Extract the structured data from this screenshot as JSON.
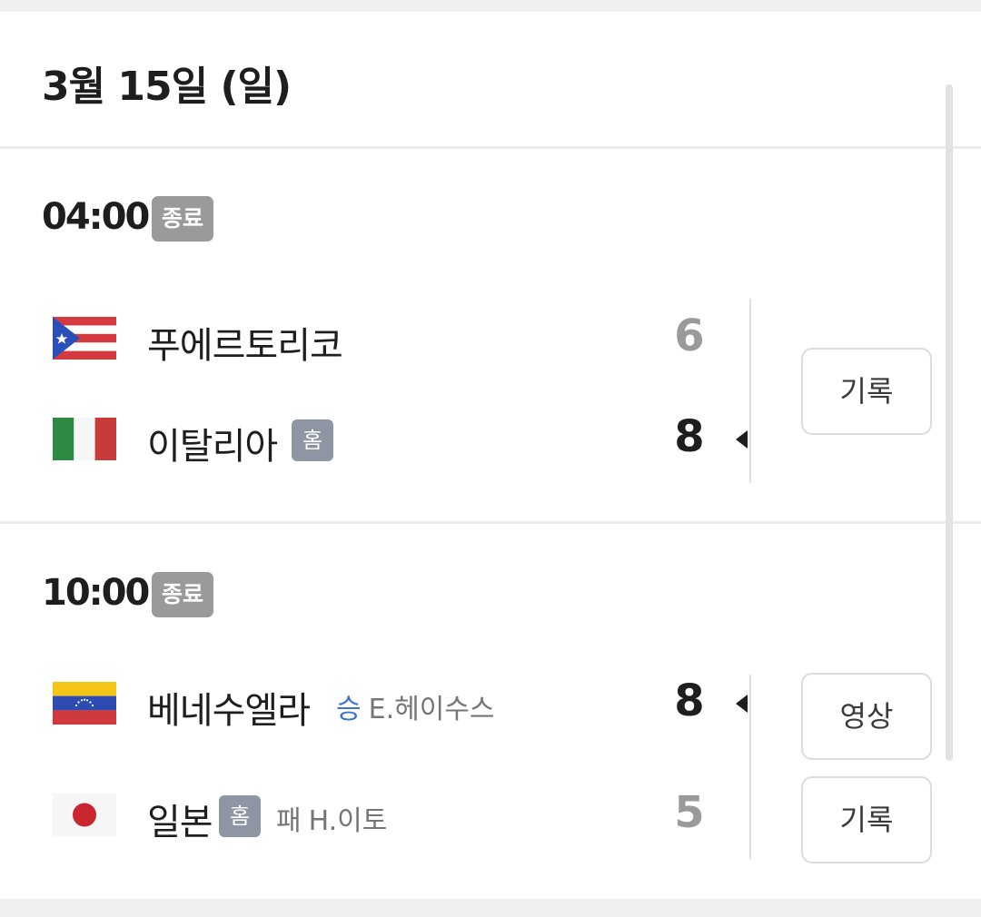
{
  "date": {
    "title": "3월 15일 (일)"
  },
  "games": [
    {
      "time": "04:00",
      "status": "종료",
      "teams": [
        {
          "name": "푸에르토리코",
          "flag": "puerto-rico-flag",
          "score": "6",
          "home": false
        },
        {
          "name": "이탈리아",
          "flag": "italy-flag",
          "score": "8",
          "home": true,
          "home_label": "홈",
          "winner": true
        }
      ],
      "buttons": [
        {
          "label": "기록"
        }
      ]
    },
    {
      "time": "10:00",
      "status": "종료",
      "teams": [
        {
          "name": "베네수엘라",
          "flag": "venezuela-flag",
          "score": "8",
          "home": false,
          "winner": true,
          "pitcher_result": "승",
          "pitcher": "E.헤이수스"
        },
        {
          "name": "일본",
          "flag": "japan-flag",
          "score": "5",
          "home": true,
          "home_label": "홈",
          "pitcher_result": "패",
          "pitcher": "H.이토"
        }
      ],
      "buttons": [
        {
          "label": "영상"
        },
        {
          "label": "기록"
        }
      ]
    }
  ],
  "colors": {
    "win_text": "#3a74d0",
    "status_badge": "#9a9a9a",
    "home_badge": "#8e96a4"
  }
}
